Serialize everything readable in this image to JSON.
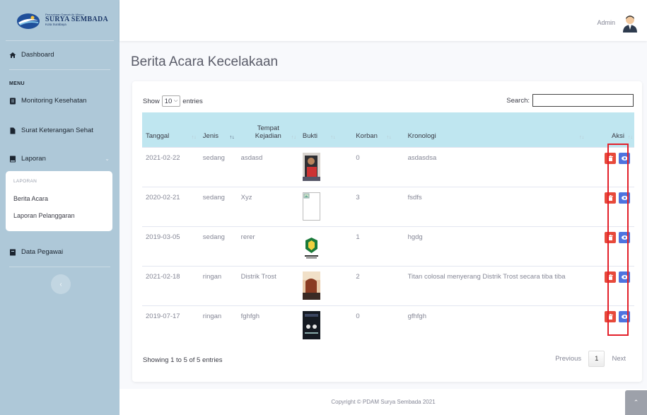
{
  "brand": {
    "small": "Perusahaan Daerah Air Minum",
    "name": "SURYA SEMBADA",
    "city": "Kota Surabaya"
  },
  "sidebar": {
    "dashboard": "Dashboard",
    "menu_heading": "MENU",
    "monitoring": "Monitoring Kesehatan",
    "surat": "Surat Keterangan Sehat",
    "laporan": "Laporan",
    "submenu_heading": "LAPORAN",
    "sub_items": [
      "Berita Acara",
      "Laporan Pelanggaran"
    ],
    "pegawai": "Data Pegawai"
  },
  "topbar": {
    "user": "Admin"
  },
  "page": {
    "title": "Berita Acara Kecelakaan"
  },
  "table_controls": {
    "show": "Show",
    "length": "10",
    "entries": "entries",
    "search_label": "Search:",
    "search_value": ""
  },
  "columns": [
    "Tanggal",
    "Jenis",
    "Tempat Kejadian",
    "Bukti",
    "Korban",
    "Kronologi",
    "Aksi"
  ],
  "rows": [
    {
      "tanggal": "2021-02-22",
      "jenis": "sedang",
      "tempat": "asdasd",
      "bukti": "photo-person",
      "korban": "0",
      "kronologi": "asdasdsa"
    },
    {
      "tanggal": "2020-02-21",
      "jenis": "sedang",
      "tempat": "Xyz",
      "bukti": "broken-image",
      "korban": "3",
      "kronologi": "fsdfs"
    },
    {
      "tanggal": "2019-03-05",
      "jenis": "sedang",
      "tempat": "rerer",
      "bukti": "green-logo",
      "korban": "1",
      "kronologi": "hgdg"
    },
    {
      "tanggal": "2021-02-18",
      "jenis": "ringan",
      "tempat": "Distrik Trost",
      "bukti": "photo-titan",
      "korban": "2",
      "kronologi": "Titan colosal menyerang Distrik Trost secara tiba tiba"
    },
    {
      "tanggal": "2019-07-17",
      "jenis": "ringan",
      "tempat": "fghfgh",
      "bukti": "dark-poster",
      "korban": "0",
      "kronologi": "gfhfgh"
    }
  ],
  "footer_info": "Showing 1 to 5 of 5 entries",
  "pagination": {
    "previous": "Previous",
    "current": "1",
    "next": "Next"
  },
  "copyright": "Copyright © PDAM Surya Sembada 2021",
  "colors": {
    "sidebar": "#aec8d8",
    "header_row": "#bfe6f0",
    "delete": "#e74a3b",
    "view": "#4e73df",
    "highlight": "#e3202a"
  }
}
